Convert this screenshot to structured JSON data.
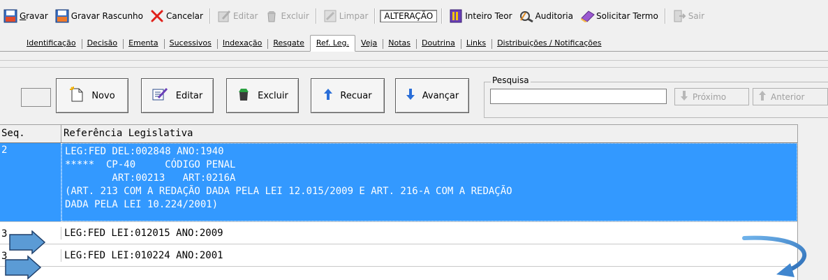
{
  "toolbar": {
    "gravar": "Gravar",
    "gravar_rascunho": "Gravar Rascunho",
    "cancelar": "Cancelar",
    "editar": "Editar",
    "excluir": "Excluir",
    "limpar": "Limpar",
    "mode": "ALTERAÇÃO",
    "inteiro_teor": "Inteiro Teor",
    "auditoria": "Auditoria",
    "solicitar_termo": "Solicitar Termo",
    "sair": "Sair"
  },
  "tabs": [
    "Identificação",
    "Decisão",
    "Ementa",
    "Sucessivos",
    "Indexação",
    "Resgate",
    "Ref. Leg.",
    "Veja",
    "Notas",
    "Doutrina",
    "Links",
    "Distribuições / Notificações"
  ],
  "active_tab": "Ref. Leg.",
  "nav": {
    "novo": "Novo",
    "editar": "Editar",
    "excluir": "Excluir",
    "recuar": "Recuar",
    "avancar": "Avançar"
  },
  "pesquisa": {
    "legend": "Pesquisa",
    "value": "",
    "proximo": "Próximo",
    "anterior": "Anterior"
  },
  "grid": {
    "col_seq": "Seq.",
    "col_ref": "Referência Legislativa",
    "rows": [
      {
        "seq": "2",
        "ref": "LEG:FED DEL:002848 ANO:1940\n*****  CP-40     CÓDIGO PENAL\n        ART:00213   ART:0216A\n(ART. 213 COM A REDAÇÃO DADA PELA LEI 12.015/2009 E ART. 216-A COM A REDAÇÃO\nDADA PELA LEI 10.224/2001)",
        "selected": true
      },
      {
        "seq": "3",
        "ref": "LEG:FED LEI:012015 ANO:2009",
        "selected": false
      },
      {
        "seq": "3",
        "ref": "LEG:FED LEI:010224 ANO:2001",
        "selected": false
      }
    ]
  },
  "colors": {
    "selection": "#3399ff",
    "arrow_fill": "#5b9bd5"
  }
}
